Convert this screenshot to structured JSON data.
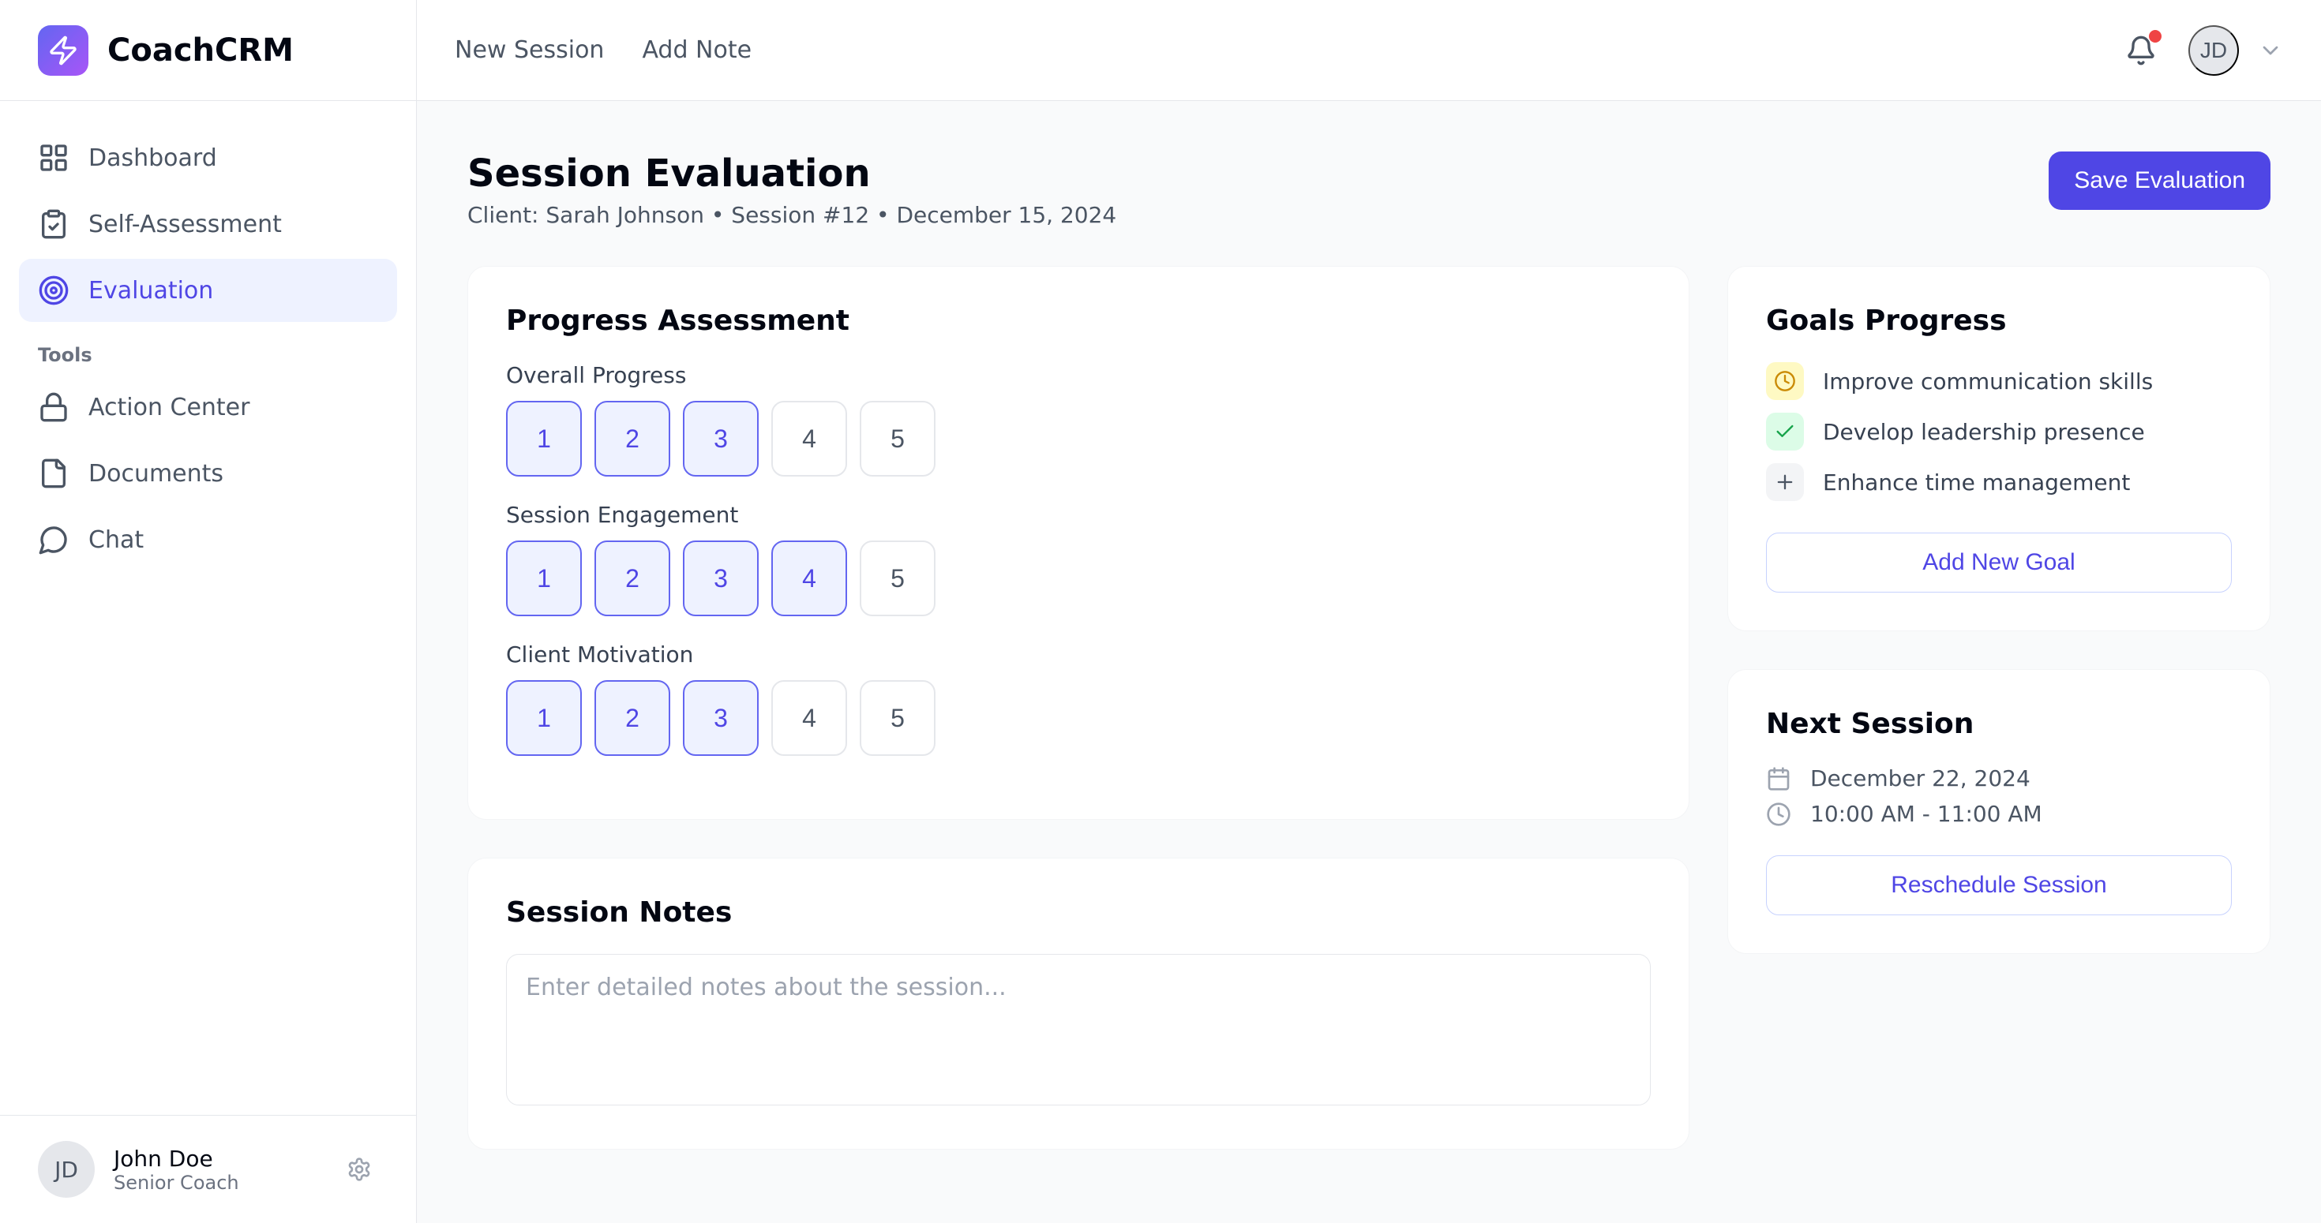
{
  "brand": "CoachCRM",
  "nav": {
    "primary": [
      {
        "label": "Dashboard"
      },
      {
        "label": "Self-Assessment"
      },
      {
        "label": "Evaluation"
      }
    ],
    "tools_label": "Tools",
    "tools": [
      {
        "label": "Action Center"
      },
      {
        "label": "Documents"
      },
      {
        "label": "Chat"
      }
    ]
  },
  "user": {
    "initials": "JD",
    "name": "John Doe",
    "role": "Senior Coach"
  },
  "top": {
    "links": [
      {
        "label": "New Session"
      },
      {
        "label": "Add Note"
      }
    ],
    "avatar": "JD"
  },
  "page": {
    "title": "Session Evaluation",
    "subtitle": "Client: Sarah Johnson • Session #12 • December 15, 2024",
    "save_label": "Save Evaluation"
  },
  "progress": {
    "title": "Progress Assessment",
    "metrics": [
      {
        "label": "Overall Progress",
        "value": 3
      },
      {
        "label": "Session Engagement",
        "value": 4
      },
      {
        "label": "Client Motivation",
        "value": 3
      }
    ],
    "scale": [
      "1",
      "2",
      "3",
      "4",
      "5"
    ]
  },
  "notes": {
    "title": "Session Notes",
    "placeholder": "Enter detailed notes about the session..."
  },
  "goals": {
    "title": "Goals Progress",
    "items": [
      {
        "status": "in-progress",
        "label": "Improve communication skills"
      },
      {
        "status": "done",
        "label": "Develop leadership presence"
      },
      {
        "status": "new",
        "label": "Enhance time management"
      }
    ],
    "add_label": "Add New Goal"
  },
  "next": {
    "title": "Next Session",
    "date": "December 22, 2024",
    "time": "10:00 AM - 11:00 AM",
    "reschedule_label": "Reschedule Session"
  }
}
